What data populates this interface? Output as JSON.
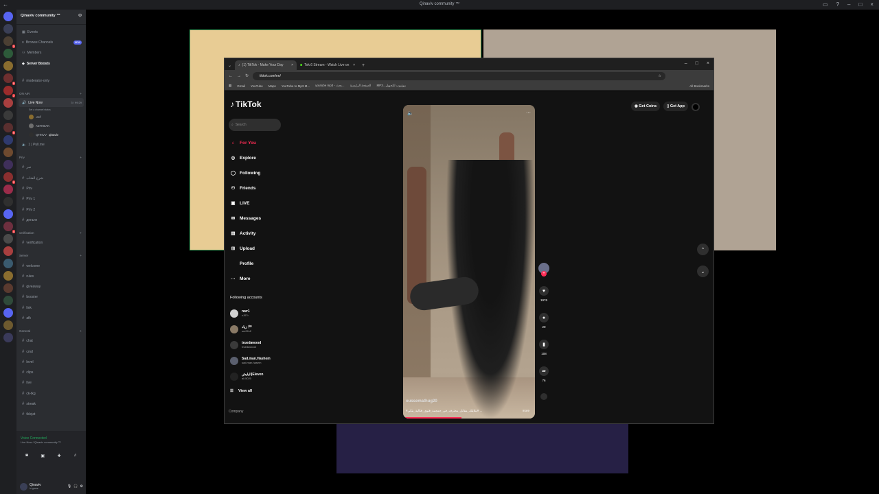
{
  "discord": {
    "app_title": "Qinaviv community ™",
    "server_name": "Qinaviv community ™",
    "channels_top": [
      {
        "label": "Events",
        "icon": "calendar-icon"
      },
      {
        "label": "Browse Channels",
        "icon": "browse-icon",
        "badge": "NEW"
      },
      {
        "label": "Members",
        "icon": "members-icon"
      },
      {
        "label": "Server Boosts",
        "icon": "boost-icon"
      }
    ],
    "mod_channel": "moderator-only",
    "on_air_category": "ON AIR",
    "live_channel": {
      "label": "Live Now",
      "status": "Set a channel status",
      "count": "3 / 99:29"
    },
    "live_users": [
      ".ecf",
      "AZ7KBAK",
      "QHNVV"
    ],
    "live_user_tag": "qinaviv",
    "pullme": "1 | Pull.me",
    "priv_category": "Priv",
    "priv_channels": [
      "نمر",
      "شرح العتاب",
      "Priv",
      "Priv 1",
      "Priv 2",
      "деньги"
    ],
    "verification_category": "verification",
    "verification_channel": "verification",
    "server_category": "Server",
    "server_channels": [
      "welcome",
      "rules",
      "giveaway",
      "booster",
      "link",
      "afk"
    ],
    "general_category": "General",
    "general_channels": [
      "chat",
      "cmd",
      "level",
      "clips",
      "live",
      "ck-tkg",
      "streak",
      "tklejat"
    ],
    "voice": {
      "title": "Voice Connected",
      "sub": "Live Now / Qinaviv community ™"
    },
    "me": {
      "name": "Qinaviv",
      "status": "In game"
    },
    "new_badge": "NEW"
  },
  "browser": {
    "tabs": [
      {
        "label": "(1) TikTok - Make Your Day",
        "active": true
      },
      {
        "label": "Tok.6 Stream - Watch Live on",
        "active": false
      }
    ],
    "url": "tiktok.com/en/",
    "bookmarks": [
      "Gmail",
      "YouTube",
      "Maps",
      "YouTube to Mp3 M...",
      "youtube mp3 - بحث...",
      "الصفحة الرئيسية",
      "MP3...بيوتيوب للتحويل"
    ],
    "all_bookmarks": "All Bookmarks"
  },
  "tiktok": {
    "brand": "TikTok",
    "search_placeholder": "Search",
    "nav": [
      {
        "label": "For You",
        "icon": "home-icon",
        "active": true
      },
      {
        "label": "Explore",
        "icon": "compass-icon"
      },
      {
        "label": "Following",
        "icon": "following-icon"
      },
      {
        "label": "Friends",
        "icon": "friends-icon"
      },
      {
        "label": "LIVE",
        "icon": "live-icon"
      },
      {
        "label": "Messages",
        "icon": "message-icon"
      },
      {
        "label": "Activity",
        "icon": "bell-icon"
      },
      {
        "label": "Upload",
        "icon": "upload-icon"
      },
      {
        "label": "Profile",
        "icon": "profile-icon"
      },
      {
        "label": "More",
        "icon": "more-icon"
      }
    ],
    "following_title": "Following accounts",
    "accounts": [
      {
        "name": "nwr1",
        "handle": "zJ07r"
      },
      {
        "name": "زياد 🏁",
        "handle": "sm22x2"
      },
      {
        "name": "truedawood",
        "handle": "truedawood"
      },
      {
        "name": "Sad.man.Hashem",
        "handle": "sad.man.hasem"
      },
      {
        "name": "اليليش|Eleven",
        "handle": "ali.5020"
      }
    ],
    "view_all": "View all",
    "company": "Company",
    "get_coins": "Get Coins",
    "get_app": "Get App",
    "video": {
      "username": "oussemathug20",
      "caption": "#بتلايلك_مقاتل_محترف_في_جمجمة_قتوي_قتالية_بتكي# ...",
      "more": "more",
      "likes": "1976",
      "comments": "20",
      "saves": "108",
      "shares": "76"
    }
  }
}
